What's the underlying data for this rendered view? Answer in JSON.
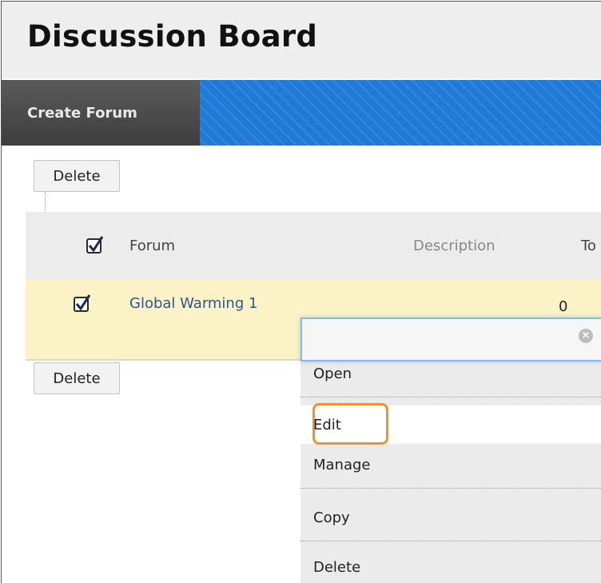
{
  "page": {
    "title": "Discussion Board"
  },
  "action_bar": {
    "create_forum_label": "Create Forum"
  },
  "toolbar": {
    "delete_label": "Delete"
  },
  "table": {
    "columns": {
      "forum": "Forum",
      "description": "Description",
      "total_truncated": "To"
    },
    "rows": [
      {
        "forum": "Global Warming 1",
        "total": "0",
        "checked": true
      }
    ],
    "select_all_checked": true
  },
  "context_menu": {
    "items": [
      "Open",
      "Edit",
      "Manage",
      "Copy",
      "Delete"
    ],
    "highlighted": "Edit",
    "close_icon": "close-icon"
  },
  "colors": {
    "action_bar": "#1e7ad4",
    "create_button": "#4a4a4a",
    "row_highlight": "#fbf3c5",
    "link": "#2b5594",
    "edit_highlight": "#f0932b"
  }
}
